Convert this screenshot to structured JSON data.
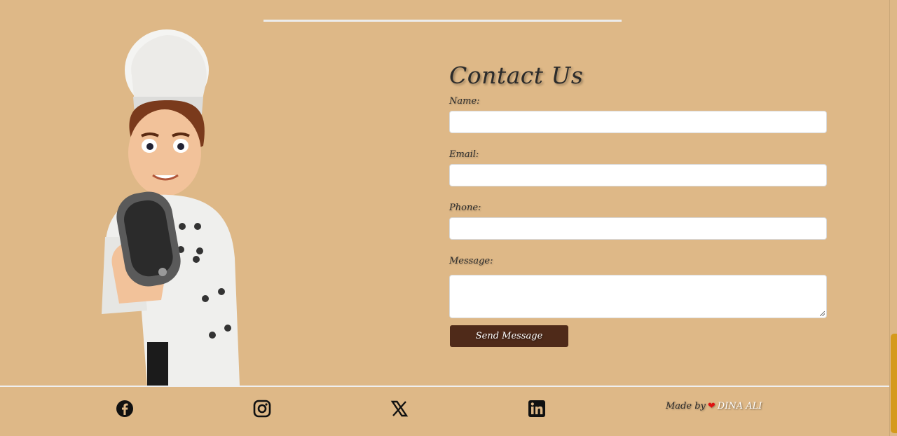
{
  "contact": {
    "title": "Contact Us",
    "name_label": "Name:",
    "email_label": "Email:",
    "phone_label": "Phone:",
    "message_label": "Message:",
    "name_value": "",
    "email_value": "",
    "phone_value": "",
    "message_value": "",
    "submit_label": "Send Message"
  },
  "footer": {
    "social": [
      {
        "icon": "facebook-icon"
      },
      {
        "icon": "instagram-icon"
      },
      {
        "icon": "x-icon"
      },
      {
        "icon": "linkedin-icon"
      }
    ],
    "made_by": "Made by",
    "author": "DINA ALI"
  },
  "colors": {
    "background": "#deb887",
    "button": "#4f2a19",
    "heart": "#e01010",
    "scroll_thumb": "#d59a1c"
  }
}
